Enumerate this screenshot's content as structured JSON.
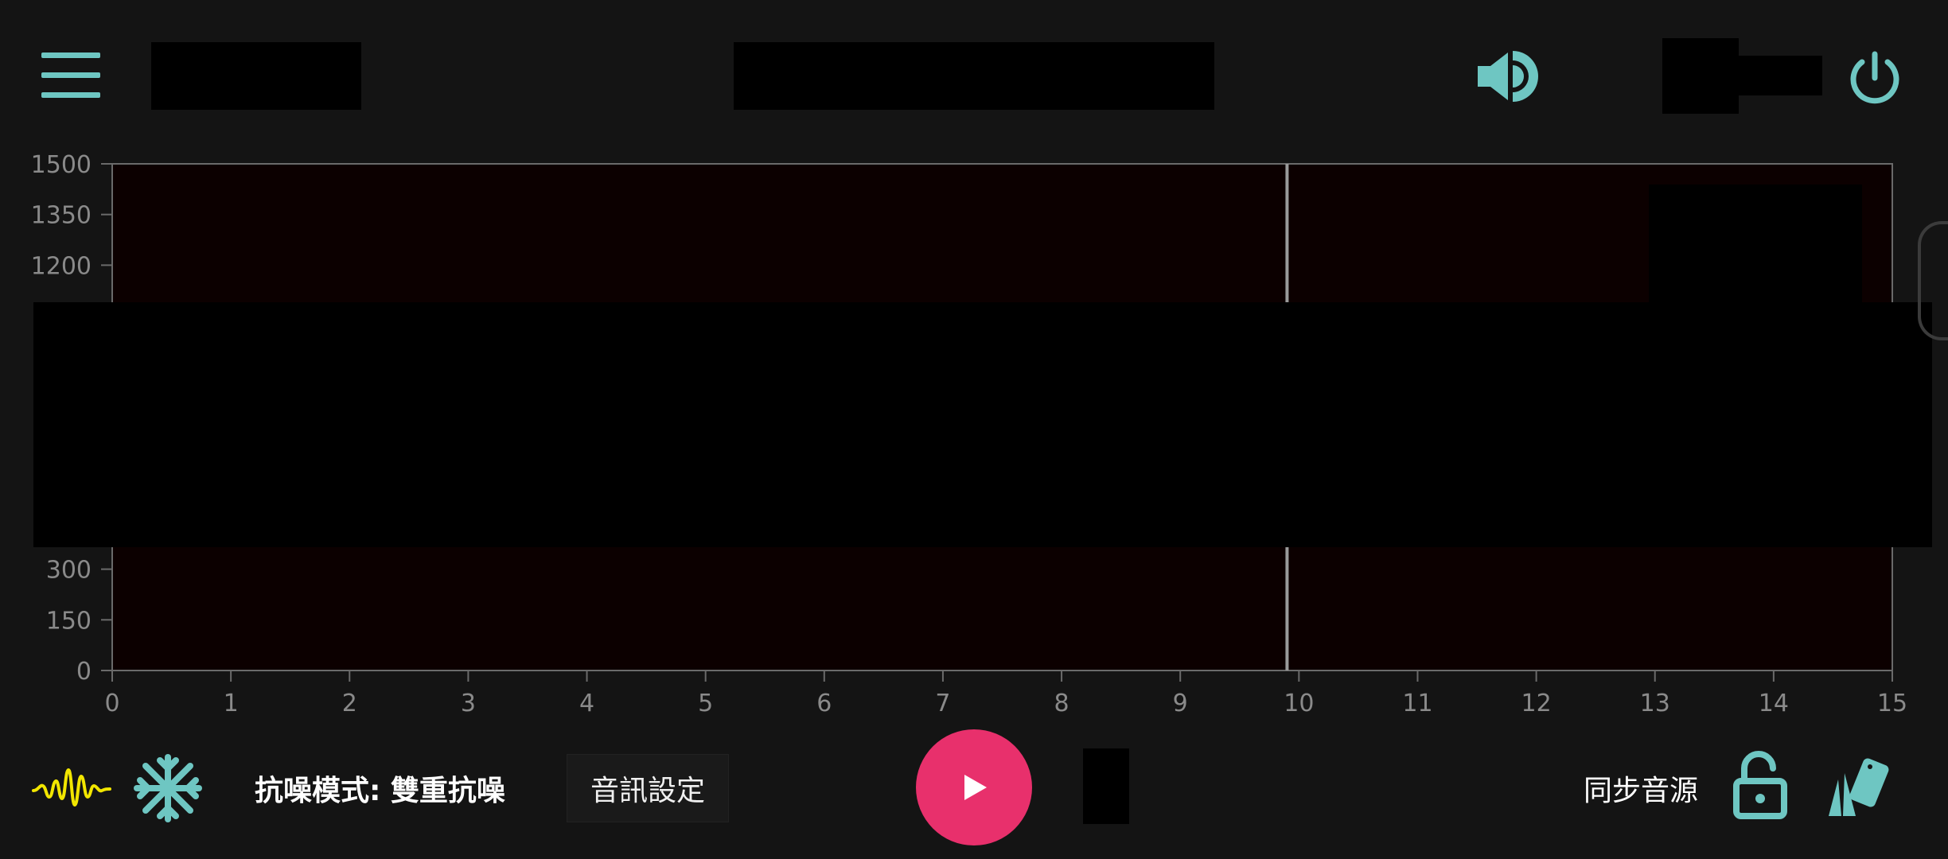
{
  "header": {
    "menu_icon": "menu-icon",
    "volume_icon": "volume-icon",
    "power_icon": "power-icon"
  },
  "chart_data": {
    "type": "heatmap",
    "y_ticks": [
      "1500",
      "1350",
      "1200",
      "300",
      "150",
      "0"
    ],
    "y_values": [
      1500,
      1350,
      1200,
      300,
      150,
      0
    ],
    "ylim": [
      0,
      1500
    ],
    "x_ticks": [
      "0",
      "1",
      "2",
      "3",
      "4",
      "5",
      "6",
      "7",
      "8",
      "9",
      "10",
      "11",
      "12",
      "13",
      "14",
      "15"
    ],
    "xlim": [
      0,
      15
    ],
    "cursor_x": 9.9,
    "background_color": "#0c0000",
    "grid": false
  },
  "footer": {
    "waveform_icon": "waveform-icon",
    "freeze_icon": "snowflake-icon",
    "mode_label": "抗噪模式: 雙重抗噪",
    "audio_settings_label": "音訊設定",
    "play_icon": "play-icon",
    "sync_label": "同步音源",
    "lock_icon": "unlock-icon",
    "cards_icon": "cards-icon"
  },
  "colors": {
    "accent": "#6ec6c2",
    "play_button": "#e8306c",
    "waveform": "#f2e600"
  }
}
